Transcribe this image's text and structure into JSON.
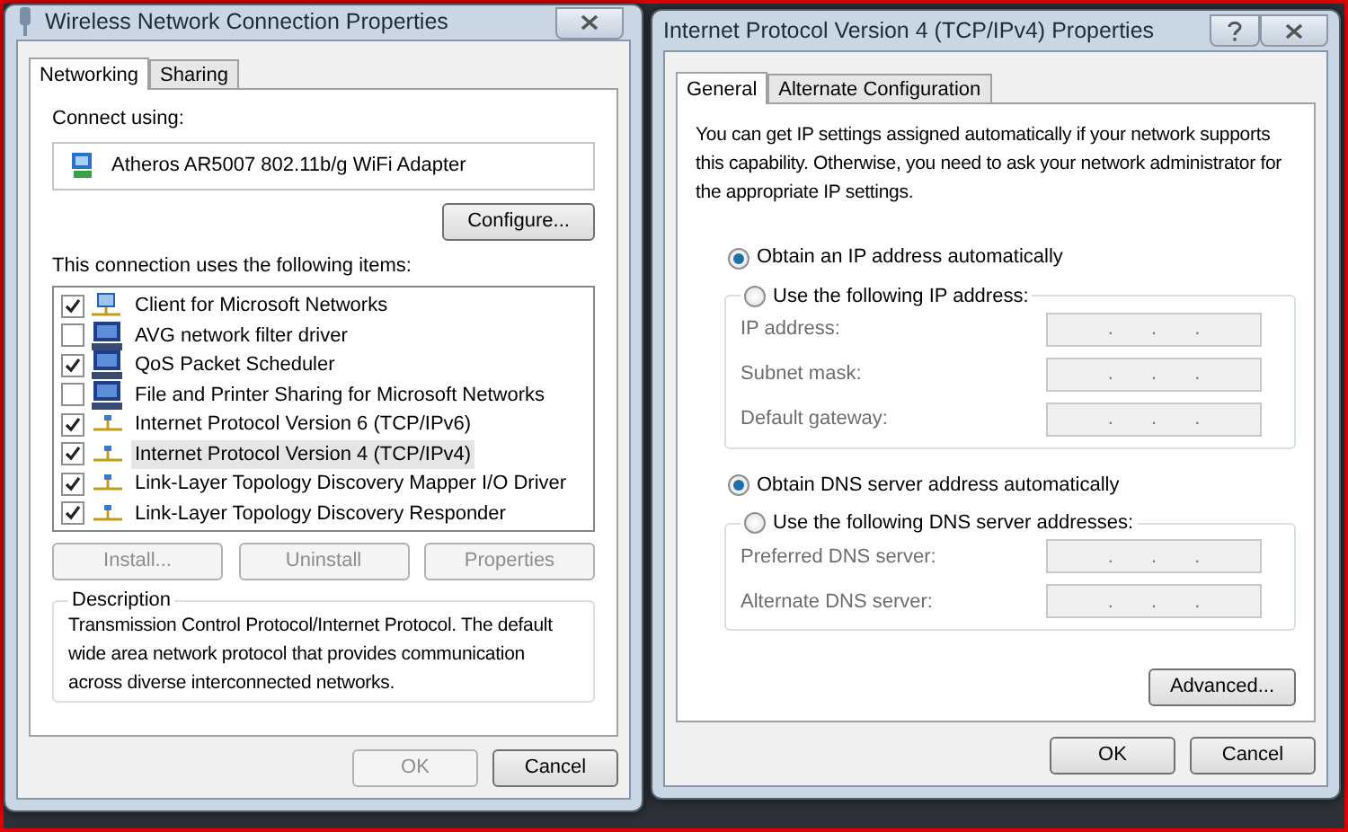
{
  "left_dialog": {
    "title": "Wireless Network Connection Properties",
    "tabs": [
      {
        "label": "Networking",
        "selected": true
      },
      {
        "label": "Sharing",
        "selected": false
      }
    ],
    "connect_label": "Connect using:",
    "adapter": "Atheros AR5007 802.11b/g WiFi Adapter",
    "configure_button": "Configure...",
    "items_label": "This connection uses the following items:",
    "items": [
      {
        "label": "Client for Microsoft Networks",
        "checked": true,
        "selected": false,
        "kind": "client"
      },
      {
        "label": "AVG network filter driver",
        "checked": false,
        "selected": false,
        "kind": "service"
      },
      {
        "label": "QoS Packet Scheduler",
        "checked": true,
        "selected": false,
        "kind": "service"
      },
      {
        "label": "File and Printer Sharing for Microsoft Networks",
        "checked": false,
        "selected": false,
        "kind": "service"
      },
      {
        "label": "Internet Protocol Version 6 (TCP/IPv6)",
        "checked": true,
        "selected": false,
        "kind": "protocol"
      },
      {
        "label": "Internet Protocol Version 4 (TCP/IPv4)",
        "checked": true,
        "selected": true,
        "kind": "protocol"
      },
      {
        "label": "Link-Layer Topology Discovery Mapper I/O Driver",
        "checked": true,
        "selected": false,
        "kind": "protocol"
      },
      {
        "label": "Link-Layer Topology Discovery Responder",
        "checked": true,
        "selected": false,
        "kind": "protocol"
      }
    ],
    "item_buttons": [
      {
        "label": "Install...",
        "disabled": true
      },
      {
        "label": "Uninstall",
        "disabled": true
      },
      {
        "label": "Properties",
        "disabled": true
      }
    ],
    "description": {
      "title": "Description",
      "text": "Transmission Control Protocol/Internet Protocol. The default wide area network protocol that provides communication across diverse interconnected networks."
    },
    "footer_buttons": [
      {
        "label": "OK",
        "disabled": true
      },
      {
        "label": "Cancel",
        "disabled": false
      }
    ]
  },
  "right_dialog": {
    "title": "Internet Protocol Version 4 (TCP/IPv4) Properties",
    "tabs": [
      {
        "label": "General",
        "selected": true
      },
      {
        "label": "Alternate Configuration",
        "selected": false
      }
    ],
    "intro": "You can get IP settings assigned automatically if your network supports this capability. Otherwise, you need to ask your network administrator for the appropriate IP settings.",
    "ip_options": [
      {
        "label": "Obtain an IP address automatically",
        "selected": true
      },
      {
        "label": "Use the following IP address:",
        "selected": false
      }
    ],
    "ip_fields": [
      {
        "label": "IP address:",
        "value": ". . .",
        "disabled": true
      },
      {
        "label": "Subnet mask:",
        "value": ". . .",
        "disabled": true
      },
      {
        "label": "Default gateway:",
        "value": ". . .",
        "disabled": true
      }
    ],
    "dns_options": [
      {
        "label": "Obtain DNS server address automatically",
        "selected": true
      },
      {
        "label": "Use the following DNS server addresses:",
        "selected": false
      }
    ],
    "dns_fields": [
      {
        "label": "Preferred DNS server:",
        "value": ". . .",
        "disabled": true
      },
      {
        "label": "Alternate DNS server:",
        "value": ". . .",
        "disabled": true
      }
    ],
    "advanced_button": "Advanced...",
    "footer_buttons": [
      {
        "label": "OK",
        "disabled": false
      },
      {
        "label": "Cancel",
        "disabled": false
      }
    ]
  }
}
